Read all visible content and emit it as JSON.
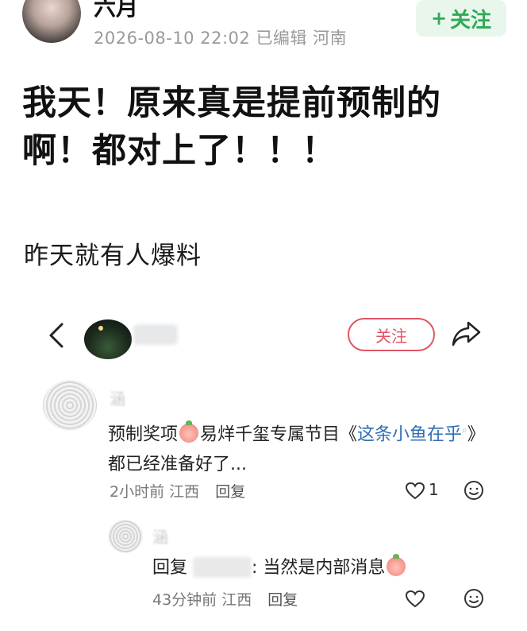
{
  "post": {
    "author_name": "六月",
    "timestamp": "2026-08-10 22:02",
    "edited_label": "已编辑",
    "location": "河南",
    "follow_label": "关注",
    "follow_plus": "+",
    "title": "我天！原来真是提前预制的啊！都对上了！！！",
    "body": "昨天就有人爆料"
  },
  "embedded": {
    "follow_label": "关注",
    "icons": [
      "back-arrow-icon",
      "share-icon",
      "heart-icon",
      "smile-icon",
      "search-icon"
    ]
  },
  "comments": [
    {
      "name": "涵",
      "text_part1": "预制奖项",
      "text_part2": "易烊千玺专属节目《",
      "link_text": "这条小鱼在乎",
      "text_part3": "》都已经准备好了...",
      "time": "2小时前",
      "location": "江西",
      "reply_label": "回复",
      "likes": "1"
    },
    {
      "name": "涵",
      "reply_prefix": "回复",
      "text": ": 当然是内部消息",
      "time": "43分钟前",
      "location": "江西",
      "reply_label": "回复"
    }
  ],
  "colors": {
    "follow_green": "#2faa55",
    "follow_green_bg": "#e8f6ec",
    "follow_red": "#e05566",
    "link_blue": "#2f6fb5"
  }
}
